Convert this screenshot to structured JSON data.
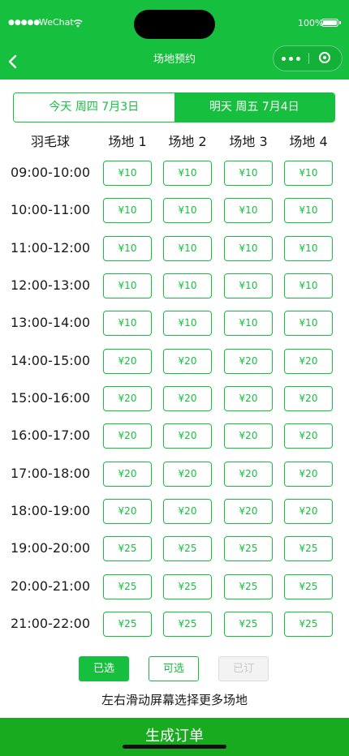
{
  "status_bar": {
    "signal": "●●●●●",
    "carrier": "WeChat",
    "battery_percent": "100%"
  },
  "nav": {
    "title": "场地预约"
  },
  "date_tabs": [
    {
      "label": "今天 周四 7月3日",
      "active": false
    },
    {
      "label": "明天 周五 7月4日",
      "active": true
    }
  ],
  "grid": {
    "sport": "羽毛球",
    "courts": [
      "场地 1",
      "场地 2",
      "场地 3",
      "场地 4"
    ],
    "rows": [
      {
        "time": "09:00-10:00",
        "prices": [
          "¥10",
          "¥10",
          "¥10",
          "¥10"
        ]
      },
      {
        "time": "10:00-11:00",
        "prices": [
          "¥10",
          "¥10",
          "¥10",
          "¥10"
        ]
      },
      {
        "time": "11:00-12:00",
        "prices": [
          "¥10",
          "¥10",
          "¥10",
          "¥10"
        ]
      },
      {
        "time": "12:00-13:00",
        "prices": [
          "¥10",
          "¥10",
          "¥10",
          "¥10"
        ]
      },
      {
        "time": "13:00-14:00",
        "prices": [
          "¥10",
          "¥10",
          "¥10",
          "¥10"
        ]
      },
      {
        "time": "14:00-15:00",
        "prices": [
          "¥20",
          "¥20",
          "¥20",
          "¥20"
        ]
      },
      {
        "time": "15:00-16:00",
        "prices": [
          "¥20",
          "¥20",
          "¥20",
          "¥20"
        ]
      },
      {
        "time": "16:00-17:00",
        "prices": [
          "¥20",
          "¥20",
          "¥20",
          "¥20"
        ]
      },
      {
        "time": "17:00-18:00",
        "prices": [
          "¥20",
          "¥20",
          "¥20",
          "¥20"
        ]
      },
      {
        "time": "18:00-19:00",
        "prices": [
          "¥20",
          "¥20",
          "¥20",
          "¥20"
        ]
      },
      {
        "time": "19:00-20:00",
        "prices": [
          "¥25",
          "¥25",
          "¥25",
          "¥25"
        ]
      },
      {
        "time": "20:00-21:00",
        "prices": [
          "¥25",
          "¥25",
          "¥25",
          "¥25"
        ]
      },
      {
        "time": "21:00-22:00",
        "prices": [
          "¥25",
          "¥25",
          "¥25",
          "¥25"
        ]
      }
    ]
  },
  "legend": {
    "selected": "已选",
    "available": "可选",
    "booked": "已订"
  },
  "hint": "左右滑动屏幕选择更多场地",
  "submit_label": "生成订单",
  "colors": {
    "primary": "#16c03e",
    "submit": "#18ab1f",
    "booked_bg": "#f3f3f3"
  }
}
